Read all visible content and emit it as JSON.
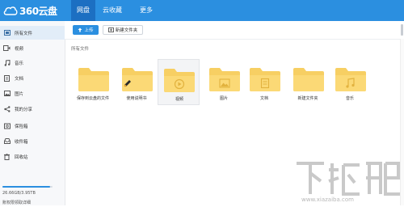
{
  "app": {
    "logo_text": "360云盘",
    "tabs": [
      {
        "label": "网盘"
      },
      {
        "label": "云收藏"
      },
      {
        "label": "更多"
      }
    ]
  },
  "sidebar": {
    "items": [
      {
        "label": "所有文件",
        "icon": "all-files-icon"
      },
      {
        "label": "视频",
        "icon": "video-icon"
      },
      {
        "label": "音乐",
        "icon": "music-icon"
      },
      {
        "label": "文档",
        "icon": "document-icon"
      },
      {
        "label": "图片",
        "icon": "image-icon"
      },
      {
        "label": "我的分享",
        "icon": "share-icon"
      },
      {
        "label": "保险箱",
        "icon": "safe-icon"
      },
      {
        "label": "收件箱",
        "icon": "inbox-icon"
      },
      {
        "label": "回收站",
        "icon": "recycle-bin-icon"
      }
    ],
    "storage": {
      "used_fraction": 0.95,
      "text": "26.66GB/3.95TB",
      "subtext": "账权限领取详细"
    }
  },
  "toolbar": {
    "upload_label": "上传",
    "new_folder_label": "新建文件夹"
  },
  "breadcrumb": "所有文件",
  "folders": [
    {
      "label": "保存到云盘的文件",
      "icon": "plain"
    },
    {
      "label": "使用说明书",
      "icon": "document"
    },
    {
      "label": "视频",
      "icon": "video"
    },
    {
      "label": "图片",
      "icon": "image"
    },
    {
      "label": "文档",
      "icon": "doc"
    },
    {
      "label": "新建文件夹",
      "icon": "plain"
    },
    {
      "label": "音乐",
      "icon": "music"
    }
  ],
  "watermark": {
    "text": "下载吧",
    "url": "www.xiazaiba.com"
  },
  "colors": {
    "brand": "#2b8fe0",
    "brand_dark": "#1c6fc2",
    "folder": "#f7cf63"
  }
}
